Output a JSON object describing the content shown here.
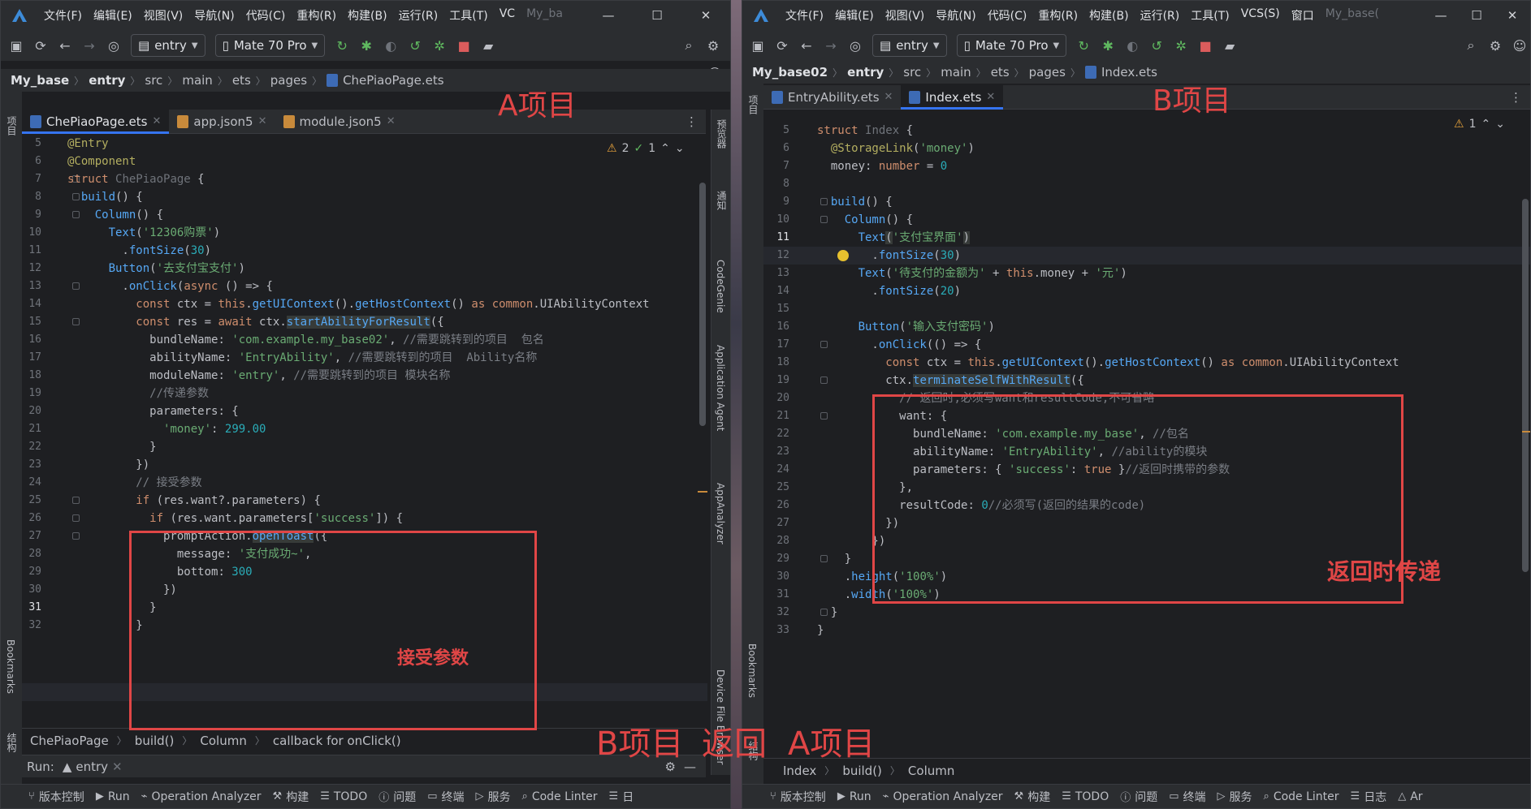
{
  "windowA": {
    "menu": [
      "文件(F)",
      "编辑(E)",
      "视图(V)",
      "导航(N)",
      "代码(C)",
      "重构(R)",
      "构建(B)",
      "运行(R)",
      "工具(T)",
      "VC"
    ],
    "project_dim": "My_ba",
    "toolbar": {
      "module": "entry",
      "device": "Mate 70 Pro"
    },
    "breadcrumb": [
      "My_base",
      "entry",
      "src",
      "main",
      "ets",
      "pages",
      "ChePiaoPage.ets"
    ],
    "tabs": [
      "ChePiaoPage.ets",
      "app.json5",
      "module.json5"
    ],
    "inspections": {
      "warnings": "2",
      "ok": "1"
    },
    "right_tools": [
      "预览器",
      "通知",
      "CodeGenie",
      "Application Agent",
      "AppAnalyzer",
      "Device File Browser"
    ],
    "left_tools": [
      "项目",
      "Bookmarks",
      "结构"
    ],
    "code_breadcrumb": [
      "ChePiaoPage",
      "build()",
      "Column",
      "callback for onClick()"
    ],
    "run": {
      "label": "Run:",
      "config": "entry"
    },
    "annotation_title": "A项目",
    "annotation_box": "接受参数",
    "code": {
      "l5": "@Entry",
      "l6": "@Component",
      "l7a": "struct ",
      "l7b": "ChePiaoPage",
      "l7c": " {",
      "l8a": "  ",
      "l8b": "build",
      "l8c": "() {",
      "l9a": "    ",
      "l9b": "Column",
      "l9c": "() {",
      "l10a": "      ",
      "l10b": "Text",
      "l10c": "(",
      "l10d": "'12306购票'",
      "l10e": ")",
      "l11a": "        .",
      "l11b": "fontSize",
      "l11c": "(",
      "l11d": "30",
      "l11e": ")",
      "l12a": "      ",
      "l12b": "Button",
      "l12c": "(",
      "l12d": "'去支付宝支付'",
      "l12e": ")",
      "l13a": "        .",
      "l13b": "onClick",
      "l13c": "(",
      "l13d": "async",
      "l13e": " () => {",
      "l14a": "          ",
      "l14b": "const",
      "l14c": " ctx = ",
      "l14d": "this",
      "l14e": ".",
      "l14f": "getUIContext",
      "l14g": "().",
      "l14h": "getHostContext",
      "l14i": "() ",
      "l14j": "as",
      "l14k": " ",
      "l14l": "common",
      "l14m": ".UIAbilityContext",
      "l15a": "          ",
      "l15b": "const",
      "l15c": " res = ",
      "l15d": "await",
      "l15e": " ctx.",
      "l15f": "startAbilityForResult",
      "l15g": "({",
      "l16a": "            ",
      "l16b": "bundleName",
      "l16c": ": ",
      "l16d": "'com.example.my_base02'",
      "l16e": ", ",
      "l16f": "//需要跳转到的项目  包名",
      "l17a": "            ",
      "l17b": "abilityName",
      "l17c": ": ",
      "l17d": "'EntryAbility'",
      "l17e": ", ",
      "l17f": "//需要跳转到的项目  Ability名称",
      "l18a": "            ",
      "l18b": "moduleName",
      "l18c": ": ",
      "l18d": "'entry'",
      "l18e": ", ",
      "l18f": "//需要跳转到的项目 模块名称",
      "l19a": "            ",
      "l19b": "//传递参数",
      "l20a": "            ",
      "l20b": "parameters",
      "l20c": ": {",
      "l21a": "              ",
      "l21b": "'money'",
      "l21c": ": ",
      "l21d": "299.00",
      "l22": "            }",
      "l23": "          })",
      "l24a": "          ",
      "l24b": "// 接受参数",
      "l25a": "          ",
      "l25b": "if",
      "l25c": " (res.want?.",
      "l25d": "parameters",
      "l25e": ") {",
      "l26a": "            ",
      "l26b": "if",
      "l26c": " (res.want.",
      "l26d": "parameters",
      "l26e": "[",
      "l26f": "'success'",
      "l26g": "]) {",
      "l27a": "              promptAction.",
      "l27b": "openToast",
      "l27c": "({",
      "l28a": "                ",
      "l28b": "message",
      "l28c": ": ",
      "l28d": "'支付成功~'",
      "l28e": ",",
      "l29a": "                ",
      "l29b": "bottom",
      "l29c": ": ",
      "l29d": "300",
      "l30": "              })",
      "l31": "            }",
      "l32": "          }"
    }
  },
  "windowB": {
    "menu": [
      "文件(F)",
      "编辑(E)",
      "视图(V)",
      "导航(N)",
      "代码(C)",
      "重构(R)",
      "构建(B)",
      "运行(R)",
      "工具(T)",
      "VCS(S)",
      "窗口"
    ],
    "project_dim": "My_base(",
    "toolbar": {
      "module": "entry",
      "device": "Mate 70 Pro"
    },
    "breadcrumb": [
      "My_base02",
      "entry",
      "src",
      "main",
      "ets",
      "pages",
      "Index.ets"
    ],
    "tabs": [
      "EntryAbility.ets",
      "Index.ets"
    ],
    "inspections": {
      "warnings": "1"
    },
    "left_tools": [
      "项目",
      "Bookmarks",
      "结构"
    ],
    "code_breadcrumb": [
      "Index",
      "build()",
      "Column"
    ],
    "annotation_title": "B项目",
    "annotation_box": "返回时传递",
    "code": {
      "l5a": "struct ",
      "l5b": "Index",
      "l5c": " {",
      "l6a": "  ",
      "l6b": "@StorageLink",
      "l6c": "(",
      "l6d": "'money'",
      "l6e": ")",
      "l7a": "  ",
      "l7b": "money",
      "l7c": ": ",
      "l7d": "number",
      "l7e": " = ",
      "l7f": "0",
      "l9a": "  ",
      "l9b": "build",
      "l9c": "() {",
      "l10a": "    ",
      "l10b": "Column",
      "l10c": "() {",
      "l11a": "      ",
      "l11b": "Text",
      "l11c": "(",
      "l11d": "'支付宝界面'",
      "l11e": ")",
      "l12a": "        .",
      "l12b": "fontSize",
      "l12c": "(",
      "l12d": "30",
      "l12e": ")",
      "l13a": "      ",
      "l13b": "Text",
      "l13c": "(",
      "l13d": "'待支付的金额为'",
      "l13e": " + ",
      "l13f": "this",
      "l13g": ".money + ",
      "l13h": "'元'",
      "l13i": ")",
      "l14a": "        .",
      "l14b": "fontSize",
      "l14c": "(",
      "l14d": "20",
      "l14e": ")",
      "l16a": "      ",
      "l16b": "Button",
      "l16c": "(",
      "l16d": "'输入支付密码'",
      "l16e": ")",
      "l17a": "        .",
      "l17b": "onClick",
      "l17c": "(() => {",
      "l18a": "          ",
      "l18b": "const",
      "l18c": " ctx = ",
      "l18d": "this",
      "l18e": ".",
      "l18f": "getUIContext",
      "l18g": "().",
      "l18h": "getHostContext",
      "l18i": "() ",
      "l18j": "as",
      "l18k": " ",
      "l18l": "common",
      "l18m": ".UIAbilityContext",
      "l19a": "          ctx.",
      "l19b": "terminateSelfWithResult",
      "l19c": "({",
      "l20a": "            ",
      "l20b": "// 返回时,必须写want和resultCode,不可省略",
      "l21a": "            ",
      "l21b": "want",
      "l21c": ": {",
      "l22a": "              ",
      "l22b": "bundleName",
      "l22c": ": ",
      "l22d": "'com.example.my_base'",
      "l22e": ", ",
      "l22f": "//包名",
      "l23a": "              ",
      "l23b": "abilityName",
      "l23c": ": ",
      "l23d": "'EntryAbility'",
      "l23e": ", ",
      "l23f": "//ability的模块",
      "l24a": "              ",
      "l24b": "parameters",
      "l24c": ": { ",
      "l24d": "'success'",
      "l24e": ": ",
      "l24f": "true",
      "l24g": " }",
      "l24h": "//返回时携带的参数",
      "l25": "            },",
      "l26a": "            ",
      "l26b": "resultCode",
      "l26c": ": ",
      "l26d": "0",
      "l26e": "//必须写(返回的结果的code)",
      "l27": "          })",
      "l28": "        })",
      "l29": "    }",
      "l30a": "    .",
      "l30b": "height",
      "l30c": "(",
      "l30d": "'100%'",
      "l30e": ")",
      "l31a": "    .",
      "l31b": "width",
      "l31c": "(",
      "l31d": "'100%'",
      "l31e": ")",
      "l32": "  }",
      "l33": "}"
    }
  },
  "bottom_annotation": {
    "a": "B项目",
    "b": "返回",
    "c": "A项目"
  },
  "statusbar": {
    "items": [
      "版本控制",
      "Run",
      "Operation Analyzer",
      "构建",
      "TODO",
      "问题",
      "终端",
      "服务",
      "Code Linter"
    ],
    "itemsA_tail": "日",
    "itemsB": [
      "版本控制",
      "Run",
      "Operation Analyzer",
      "构建",
      "TODO",
      "问题",
      "终端",
      "服务",
      "Code Linter",
      "日志",
      "Ar"
    ]
  },
  "colors": {
    "accent": "#3574f0",
    "annotation": "#e04646",
    "editor_bg": "#1e1f22",
    "chrome_bg": "#2b2d30"
  }
}
